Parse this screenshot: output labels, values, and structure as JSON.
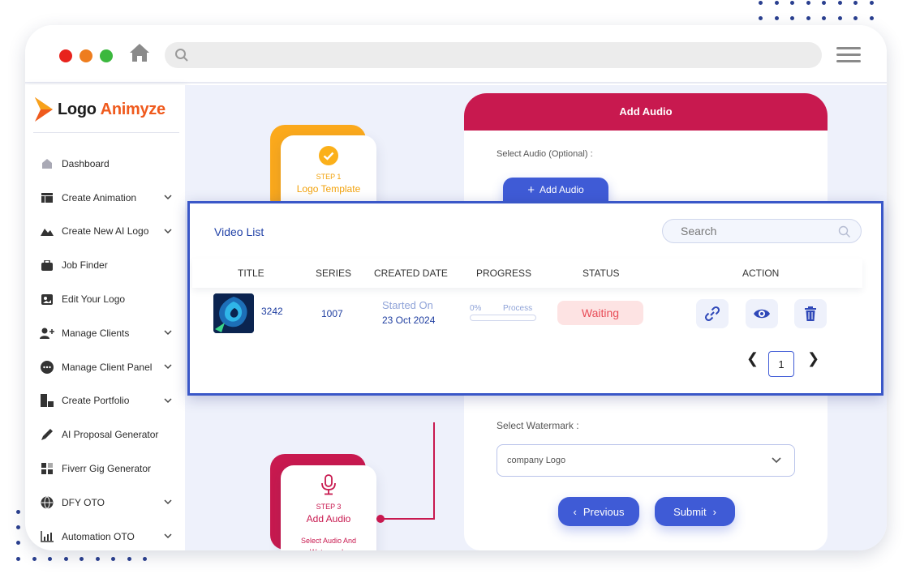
{
  "brand": {
    "logo_word1": "Logo",
    "logo_word2": "Animyze",
    "accent": "#c8194f",
    "primary": "#3f5bd6",
    "orange": "#ef5a1d"
  },
  "sidebar": {
    "items": [
      {
        "label": "Dashboard",
        "icon": "home-icon",
        "chevron": false
      },
      {
        "label": "Create Animation",
        "icon": "layout-icon",
        "chevron": true
      },
      {
        "label": "Create New AI Logo",
        "icon": "mountain-icon",
        "chevron": true
      },
      {
        "label": "Job Finder",
        "icon": "briefcase-icon",
        "chevron": false
      },
      {
        "label": "Edit Your Logo",
        "icon": "image-icon",
        "chevron": false
      },
      {
        "label": "Manage Clients",
        "icon": "add-user-icon",
        "chevron": true
      },
      {
        "label": "Manage Client Panel",
        "icon": "chat-icon",
        "chevron": true
      },
      {
        "label": "Create Portfolio",
        "icon": "portfolio-icon",
        "chevron": true
      },
      {
        "label": "AI Proposal Generator",
        "icon": "pen-icon",
        "chevron": false
      },
      {
        "label": "Fiverr Gig Generator",
        "icon": "grid-icon",
        "chevron": false
      },
      {
        "label": "DFY OTO",
        "icon": "globe-icon",
        "chevron": true
      },
      {
        "label": "Automation OTO",
        "icon": "bar-chart-icon",
        "chevron": true
      }
    ]
  },
  "steps": {
    "step1": {
      "label": "STEP 1",
      "title": "Logo Template"
    },
    "step3": {
      "label": "STEP 3",
      "title": "Add Audio",
      "desc": "Select Audio And Watermark."
    }
  },
  "panel": {
    "title": "Add Audio",
    "select_audio_label": "Select Audio (Optional) :",
    "add_audio_button": "Add Audio",
    "select_watermark_label": "Select Watermark :",
    "watermark_value": "company Logo",
    "previous_button": "Previous",
    "submit_button": "Submit"
  },
  "video_list": {
    "title": "Video List",
    "search_placeholder": "Search",
    "columns": [
      "TITLE",
      "SERIES",
      "CREATED DATE",
      "PROGRESS",
      "STATUS",
      "ACTION"
    ],
    "rows": [
      {
        "title": "3242",
        "series": "1007",
        "started_label": "Started On",
        "date": "23 Oct 2024",
        "progress_text": "0%",
        "progress_label": "Process",
        "progress": 0,
        "status": "Waiting"
      }
    ],
    "pagination": {
      "current_page": "1"
    }
  }
}
